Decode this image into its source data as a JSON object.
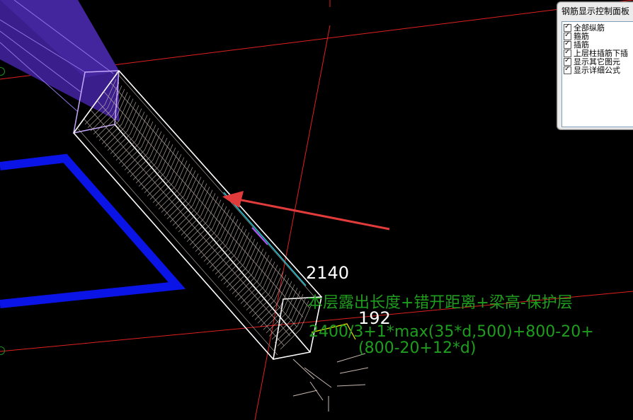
{
  "panel": {
    "title": "钢筋显示控制面板",
    "items": [
      {
        "label": "全部纵筋",
        "checked": true
      },
      {
        "label": "箍筋",
        "checked": true
      },
      {
        "label": "插筋",
        "checked": true
      },
      {
        "label": "上层柱插筋下插",
        "checked": true
      },
      {
        "label": "显示其它图元",
        "checked": true
      },
      {
        "label": "显示详细公式",
        "checked": true
      }
    ]
  },
  "dimensions": {
    "length": "2140",
    "hook": "192"
  },
  "formula": {
    "description": "本层露出长度+错开距离+梁高-保护层",
    "expression": "2400/3+1*max(35*d,500)+800-20+",
    "continuation": "(800-20+12*d)"
  },
  "colors": {
    "background": "#000000",
    "axis": "#e02020",
    "beam": "#3a1e8c",
    "slab_edge": "#0a14e6",
    "column_outline": "#ffffff",
    "rebar": "#c8b8b0",
    "formula_text": "#1f9d1f",
    "arrow": "#e23b3b",
    "highlight_rebar": "#20d0e0"
  }
}
